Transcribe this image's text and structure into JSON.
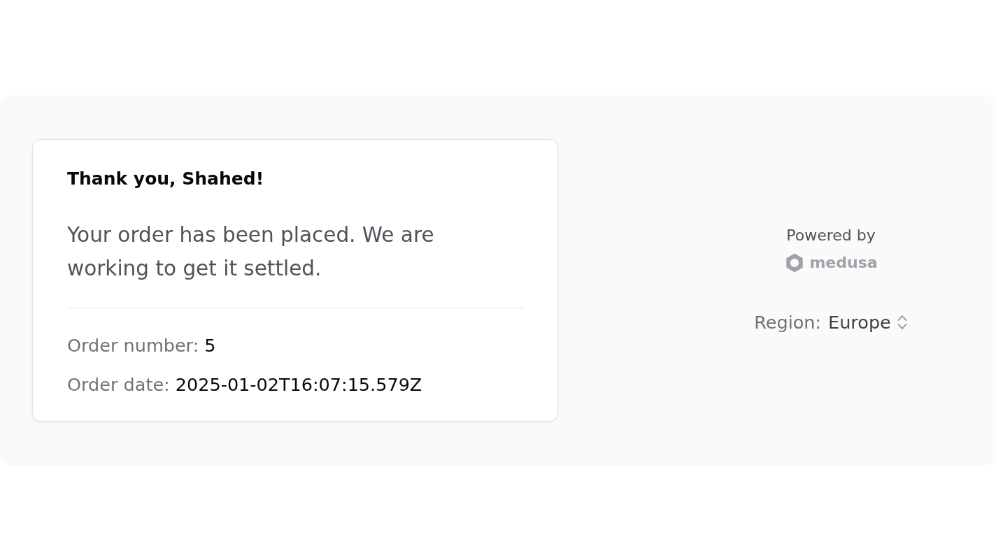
{
  "confirmation": {
    "title": "Thank you, Shahed!",
    "message": "Your order has been placed. We are working to get it settled.",
    "details": [
      {
        "label": "Order number:",
        "value": "5"
      },
      {
        "label": "Order date:",
        "value": "2025-01-02T16:07:15.579Z"
      }
    ]
  },
  "sidebar": {
    "powered_by": "Powered by",
    "brand": "medusa",
    "region": {
      "label": "Region:",
      "value": "Europe"
    }
  }
}
